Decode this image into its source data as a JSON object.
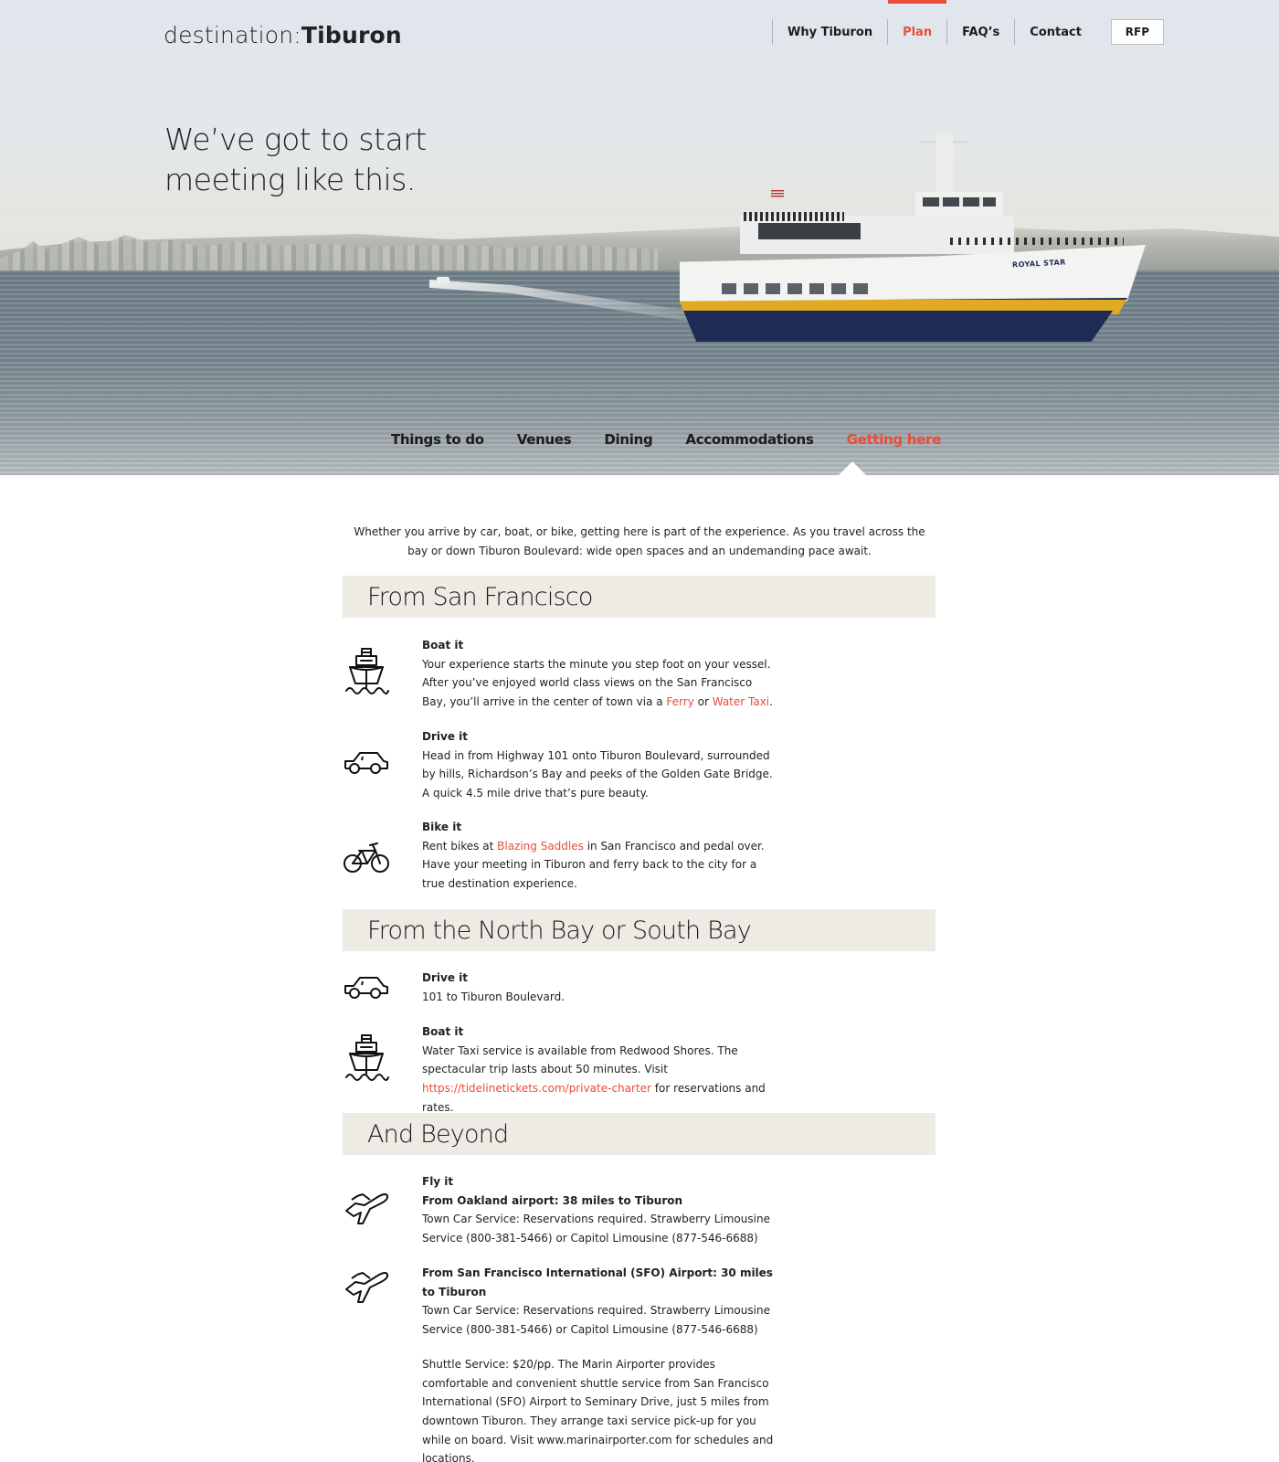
{
  "brand": {
    "logo_light": "destination:",
    "logo_bold": "Tiburon"
  },
  "topnav": {
    "items": [
      {
        "label": "Why Tiburon",
        "active": false
      },
      {
        "label": "Plan",
        "active": true
      },
      {
        "label": "FAQ’s",
        "active": false
      },
      {
        "label": "Contact",
        "active": false
      }
    ],
    "rfp_label": "RFP"
  },
  "hero": {
    "tagline_line1": "We’ve got to start",
    "tagline_line2": "meeting like this.",
    "ferry_name": "ROYAL STAR"
  },
  "subnav": {
    "items": [
      {
        "label": "Things to do",
        "active": false
      },
      {
        "label": "Venues",
        "active": false
      },
      {
        "label": "Dining",
        "active": false
      },
      {
        "label": "Accommodations",
        "active": false
      },
      {
        "label": "Getting here",
        "active": true
      }
    ]
  },
  "colors": {
    "accent": "#ea4c3b",
    "section_bg": "#eeebe4",
    "text": "#222222"
  },
  "intro": "Whether you arrive by car, boat, or bike, getting here is part of the experience. As you travel across the bay or down Tiburon Boulevard: wide open spaces and an undemanding pace await.",
  "sections": [
    {
      "heading": "From San Francisco",
      "entries": [
        {
          "icon": "ship-icon",
          "title": "Boat it",
          "text_before": "Your experience starts the minute you step foot on your vessel. After you’ve enjoyed world class views on the San Francisco Bay, you’ll arrive in the center of town via a ",
          "link1": "Ferry",
          "text_middle": " or ",
          "link2": "Water Taxi",
          "text_after": "."
        },
        {
          "icon": "car-icon",
          "title": "Drive it",
          "text": "Head in from Highway 101 onto Tiburon Boulevard, surrounded by hills, Richardson’s Bay and peeks of the Golden Gate Bridge. A quick 4.5 mile drive that’s pure beauty."
        },
        {
          "icon": "bicycle-icon",
          "title": "Bike it",
          "text_before": "Rent bikes at ",
          "link1": "Blazing Saddles",
          "text_after": " in San Francisco and pedal over. Have your meeting in Tiburon and ferry back to the city for a true destination experience."
        }
      ]
    },
    {
      "heading": "From the North Bay or South Bay",
      "entries": [
        {
          "icon": "car-icon",
          "title": "Drive it",
          "text": "101 to Tiburon Boulevard."
        },
        {
          "icon": "ship-icon",
          "title": "Boat it",
          "text_before": "Water Taxi service is available from Redwood Shores. The spectacular trip lasts about 50 minutes. Visit ",
          "link1": "https://tidelinetickets.com/private-charter",
          "text_after": " for reservations and rates."
        }
      ]
    },
    {
      "heading": "And Beyond",
      "entries": [
        {
          "icon": "airplane-icon",
          "title": "Fly it",
          "subtitle": "From Oakland airport: 38 miles to Tiburon",
          "text": "Town Car Service: Reservations required. Strawberry Limousine Service (800-381-5466) or Capitol Limousine (877-546-6688)"
        },
        {
          "icon": "airplane-icon",
          "subtitle": "From San Francisco International (SFO) Airport: 30 miles to Tiburon",
          "text": "Town Car Service: Reservations required. Strawberry Limousine Service (800-381-5466) or Capitol Limousine (877-546-6688)",
          "text2": "Shuttle Service: $20/pp. The Marin Airporter provides comfortable and convenient shuttle service from San Francisco International (SFO) Airport to Seminary Drive, just 5 miles from downtown Tiburon. They arrange taxi service pick-up for you while on board. Visit www.marinairporter.com for schedules and locations."
        }
      ]
    }
  ]
}
